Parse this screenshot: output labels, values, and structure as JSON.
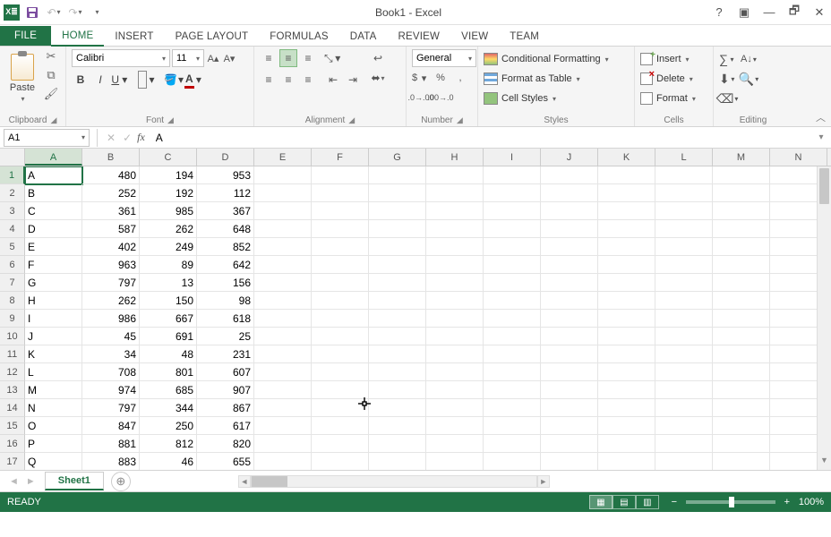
{
  "app": {
    "title": "Book1 - Excel"
  },
  "tabs": [
    "FILE",
    "HOME",
    "INSERT",
    "PAGE LAYOUT",
    "FORMULAS",
    "DATA",
    "REVIEW",
    "VIEW",
    "Team"
  ],
  "active_tab": "HOME",
  "ribbon": {
    "clipboard": {
      "label": "Clipboard",
      "paste": "Paste"
    },
    "font": {
      "label": "Font",
      "name": "Calibri",
      "size": "11"
    },
    "alignment": {
      "label": "Alignment"
    },
    "number": {
      "label": "Number",
      "format": "General"
    },
    "styles": {
      "label": "Styles",
      "conditional": "Conditional Formatting",
      "table": "Format as Table",
      "cellstyles": "Cell Styles"
    },
    "cells": {
      "label": "Cells",
      "insert": "Insert",
      "delete": "Delete",
      "format": "Format"
    },
    "editing": {
      "label": "Editing"
    }
  },
  "namebox": "A1",
  "formula": "A",
  "columns": [
    "A",
    "B",
    "C",
    "D",
    "E",
    "F",
    "G",
    "H",
    "I",
    "J",
    "K",
    "L",
    "M",
    "N"
  ],
  "rows": [
    {
      "n": 1,
      "cells": [
        "A",
        "480",
        "194",
        "953"
      ]
    },
    {
      "n": 2,
      "cells": [
        "B",
        "252",
        "192",
        "112"
      ]
    },
    {
      "n": 3,
      "cells": [
        "C",
        "361",
        "985",
        "367"
      ]
    },
    {
      "n": 4,
      "cells": [
        "D",
        "587",
        "262",
        "648"
      ]
    },
    {
      "n": 5,
      "cells": [
        "E",
        "402",
        "249",
        "852"
      ]
    },
    {
      "n": 6,
      "cells": [
        "F",
        "963",
        "89",
        "642"
      ]
    },
    {
      "n": 7,
      "cells": [
        "G",
        "797",
        "13",
        "156"
      ]
    },
    {
      "n": 8,
      "cells": [
        "H",
        "262",
        "150",
        "98"
      ]
    },
    {
      "n": 9,
      "cells": [
        "I",
        "986",
        "667",
        "618"
      ]
    },
    {
      "n": 10,
      "cells": [
        "J",
        "45",
        "691",
        "25"
      ]
    },
    {
      "n": 11,
      "cells": [
        "K",
        "34",
        "48",
        "231"
      ]
    },
    {
      "n": 12,
      "cells": [
        "L",
        "708",
        "801",
        "607"
      ]
    },
    {
      "n": 13,
      "cells": [
        "M",
        "974",
        "685",
        "907"
      ]
    },
    {
      "n": 14,
      "cells": [
        "N",
        "797",
        "344",
        "867"
      ]
    },
    {
      "n": 15,
      "cells": [
        "O",
        "847",
        "250",
        "617"
      ]
    },
    {
      "n": 16,
      "cells": [
        "P",
        "881",
        "812",
        "820"
      ]
    },
    {
      "n": 17,
      "cells": [
        "Q",
        "883",
        "46",
        "655"
      ]
    }
  ],
  "active_cell": {
    "row": 1,
    "col": 0
  },
  "sheet": {
    "name": "Sheet1"
  },
  "status": {
    "ready": "READY",
    "zoom": "100%"
  }
}
